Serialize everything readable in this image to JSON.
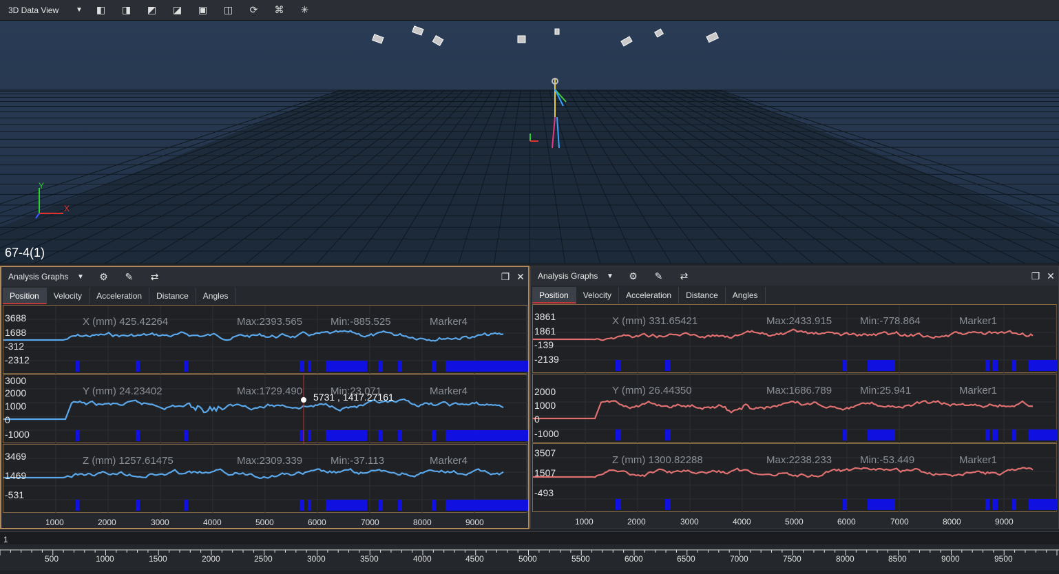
{
  "toolbar": {
    "view_name": "3D Data View",
    "icons": [
      "cube-front-icon",
      "cube-side-icon",
      "cube-top-icon",
      "cube-iso-icon",
      "cube-left-icon",
      "cube-back-icon",
      "reset-view-icon",
      "cameras-icon",
      "markers-icon"
    ]
  },
  "viewport": {
    "label": "67-4(1)",
    "axis_y": "Y",
    "axis_x": "X"
  },
  "panels": [
    {
      "title": "Analysis Graphs",
      "tabs": [
        "Position",
        "Velocity",
        "Acceleration",
        "Distance",
        "Angles"
      ],
      "active_tab": "Position",
      "color": "#5aa7ea",
      "graphs": [
        {
          "label": "X (mm) 425.42264",
          "max": "Max:2393.565",
          "min": "Min:-885.525",
          "marker": "Marker4",
          "yticks": [
            "3688",
            "1688",
            "-312",
            "-2312"
          ]
        },
        {
          "label": "Y (mm) 24.23402",
          "max": "Max:1729.490",
          "min": "Min:23.071",
          "marker": "Marker4",
          "yticks": [
            "3000",
            "2000",
            "1000",
            "0",
            "-1000"
          ]
        },
        {
          "label": "Z (mm) 1257.61475",
          "max": "Max:2309.339",
          "min": "Min:-37.113",
          "marker": "Marker4",
          "yticks": [
            "3469",
            "1469",
            "-531"
          ]
        }
      ],
      "cursor_readout": "5731 , 1417.27161",
      "xticks": [
        "1000",
        "2000",
        "3000",
        "4000",
        "5000",
        "6000",
        "7000",
        "8000",
        "9000"
      ]
    },
    {
      "title": "Analysis Graphs",
      "tabs": [
        "Position",
        "Velocity",
        "Acceleration",
        "Distance",
        "Angles"
      ],
      "active_tab": "Position",
      "color": "#e07070",
      "graphs": [
        {
          "label": "X (mm) 331.65421",
          "max": "Max:2433.915",
          "min": "Min:-778.864",
          "marker": "Marker1",
          "yticks": [
            "3861",
            "1861",
            "-139",
            "-2139"
          ]
        },
        {
          "label": "Y (mm) 26.44350",
          "max": "Max:1686.789",
          "min": "Min:25.941",
          "marker": "Marker1",
          "yticks": [
            "2000",
            "1000",
            "0",
            "-1000"
          ]
        },
        {
          "label": "Z (mm) 1300.82288",
          "max": "Max:2238.233",
          "min": "Min:-53.449",
          "marker": "Marker1",
          "yticks": [
            "3507",
            "1507",
            "-493"
          ]
        }
      ],
      "xticks": [
        "1000",
        "2000",
        "3000",
        "4000",
        "5000",
        "6000",
        "7000",
        "8000",
        "9000"
      ]
    }
  ],
  "timeline": {
    "current_frame": "1",
    "ticks": [
      "500",
      "1000",
      "1500",
      "2000",
      "2500",
      "3000",
      "3500",
      "4000",
      "4500",
      "5000",
      "5500",
      "6000",
      "6500",
      "7000",
      "7500",
      "8000",
      "8500",
      "9000",
      "9500"
    ]
  },
  "colors": {
    "accent": "#b08a5a",
    "gap_bars": "#1010e0"
  }
}
